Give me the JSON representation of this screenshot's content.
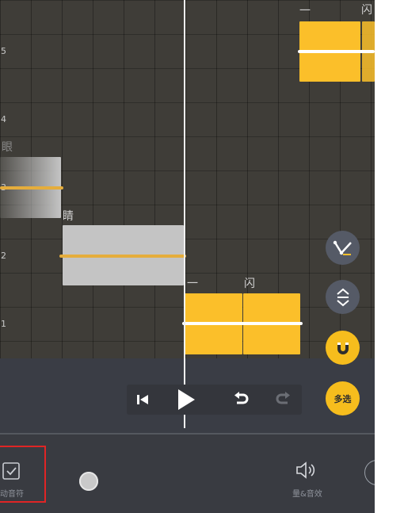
{
  "rows": [
    {
      "label": "5"
    },
    {
      "label": "4"
    },
    {
      "label": "3"
    },
    {
      "label": "2"
    },
    {
      "label": "1"
    }
  ],
  "lyrics": {
    "top_dash": "一",
    "top_partial": "闪",
    "faded_left": "眼",
    "jing": "睛",
    "mid_dash": "一",
    "mid_shan": "闪"
  },
  "tools": {
    "multi_select": "多选",
    "left_tool_label": "动音符",
    "volume_label": "量&音效"
  },
  "colors": {
    "note_active": "#fbbf2a",
    "note_inactive": "#c4c4c4",
    "highlight": "#e02525"
  },
  "icons": [
    "skip-back-icon",
    "play-icon",
    "undo-icon",
    "redo-icon",
    "pitch-line-icon",
    "expand-vertical-icon",
    "magnet-icon",
    "checkbox-icon",
    "speaker-icon"
  ]
}
